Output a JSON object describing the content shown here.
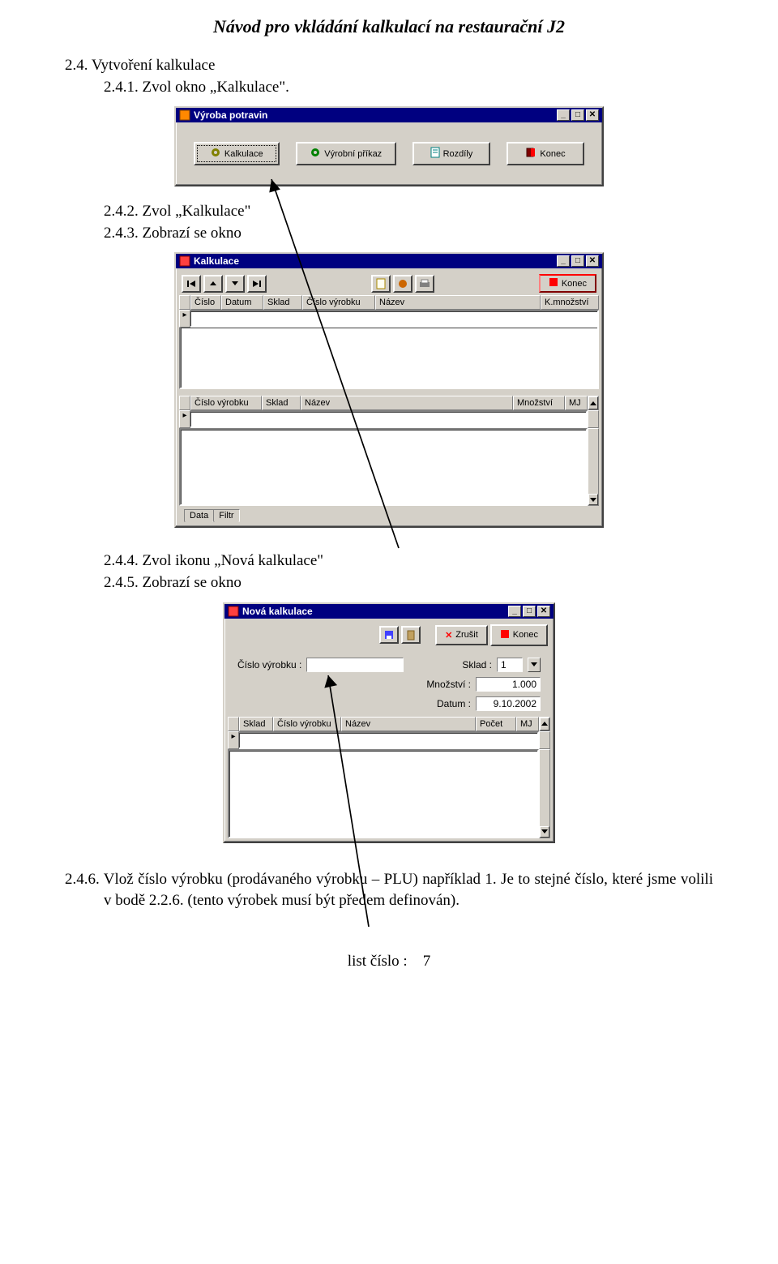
{
  "doc": {
    "title": "Návod pro vkládání kalkulací na restaurační J2",
    "s2_4": "2.4. Vytvoření kalkulace",
    "s2_4_1": "2.4.1. Zvol okno „Kalkulace\".",
    "s2_4_2": "2.4.2. Zvol „Kalkulace\"",
    "s2_4_3": "2.4.3. Zobrazí se okno",
    "s2_4_4": "2.4.4. Zvol ikonu „Nová kalkulace\"",
    "s2_4_5": "2.4.5. Zobrazí se okno",
    "s2_4_6": "2.4.6. Vlož číslo výrobku (prodávaného výrobku – PLU) například 1. Je to stejné číslo, které jsme volili v bodě 2.2.6. (tento výrobek musí být předem definován).",
    "footer_label": "list číslo :",
    "page_num": "7"
  },
  "win1": {
    "title": "Výroba potravin",
    "buttons": [
      "Kalkulace",
      "Výrobní příkaz",
      "Rozdíly",
      "Konec"
    ]
  },
  "win2": {
    "title": "Kalkulace",
    "end_btn": "Konec",
    "grid1_headers": [
      "Číslo",
      "Datum",
      "Sklad",
      "Číslo výrobku",
      "Název",
      "K.množství"
    ],
    "grid2_headers": [
      "Číslo výrobku",
      "Sklad",
      "Název",
      "Množství",
      "MJ"
    ],
    "tabs": [
      "Data",
      "Filtr"
    ]
  },
  "win3": {
    "title": "Nová kalkulace",
    "btn_zrusit": "Zrušit",
    "btn_konec": "Konec",
    "label_cislo": "Číslo výrobku :",
    "label_sklad": "Sklad :",
    "sklad_val": "1",
    "label_mnozstvi": "Množství :",
    "mnozstvi_val": "1.000",
    "label_datum": "Datum :",
    "datum_val": "9.10.2002",
    "grid_headers": [
      "Sklad",
      "Číslo výrobku",
      "Název",
      "Počet",
      "MJ"
    ]
  }
}
